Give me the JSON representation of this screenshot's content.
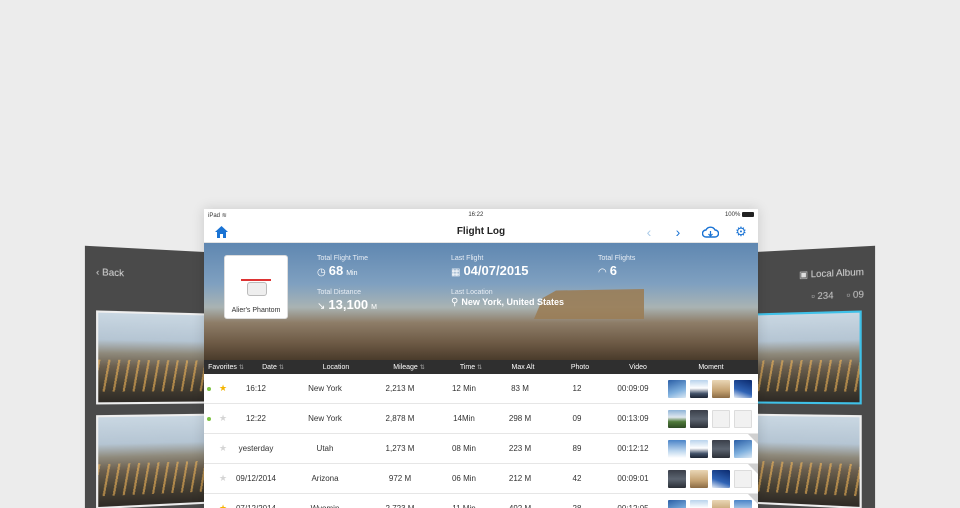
{
  "left_panel": {
    "back_label": "Back"
  },
  "right_panel": {
    "album_label": "Local Album",
    "photo_count": "234",
    "video_count": "09"
  },
  "status_bar": {
    "device": "iPad",
    "time": "16:22",
    "battery": "100%"
  },
  "nav": {
    "title": "Flight Log"
  },
  "aircraft": {
    "name": "Alier's Phantom"
  },
  "stats": {
    "total_flight_time": {
      "label": "Total Flight Time",
      "value": "68",
      "unit": "Min"
    },
    "last_flight": {
      "label": "Last Flight",
      "value": "04/07/2015"
    },
    "total_flights": {
      "label": "Total Flights",
      "value": "6"
    },
    "total_distance": {
      "label": "Total Distance",
      "value": "13,100",
      "unit": "M"
    },
    "last_location": {
      "label": "Last Location",
      "value": "New York, United States"
    }
  },
  "table": {
    "headers": [
      "Favorites",
      "Date",
      "Location",
      "Mileage",
      "Time",
      "Max Alt",
      "Photo",
      "Video",
      "Moment"
    ],
    "rows": [
      {
        "dot": true,
        "fav": true,
        "date": "16:12",
        "location": "New York",
        "mileage": "2,213 M",
        "time": "12 Min",
        "max_alt": "83 M",
        "photo": "12",
        "video": "00:09:09",
        "moments": [
          "t-sky",
          "t-mnt",
          "t-sand",
          "t-deep"
        ],
        "corner": false
      },
      {
        "dot": true,
        "fav": false,
        "date": "12:22",
        "location": "New York",
        "mileage": "2,878 M",
        "time": "14Min",
        "max_alt": "298 M",
        "photo": "09",
        "video": "00:13:09",
        "moments": [
          "t-grn",
          "t-dark",
          "t-empty",
          "t-empty"
        ],
        "corner": false
      },
      {
        "dot": false,
        "fav": false,
        "date": "yesterday",
        "location": "Utah",
        "mileage": "1,273 M",
        "time": "08 Min",
        "max_alt": "223 M",
        "photo": "89",
        "video": "00:12:12",
        "moments": [
          "t-blue",
          "t-mnt",
          "t-dark",
          "t-sky"
        ],
        "corner": true
      },
      {
        "dot": false,
        "fav": false,
        "date": "09/12/2014",
        "location": "Arizona",
        "mileage": "972 M",
        "time": "06 Min",
        "max_alt": "212 M",
        "photo": "42",
        "video": "00:09:01",
        "moments": [
          "t-dark",
          "t-sand",
          "t-deep",
          "t-empty"
        ],
        "corner": true
      },
      {
        "dot": false,
        "fav": true,
        "date": "07/12/2014",
        "location": "Wyomin",
        "mileage": "2,723 M",
        "time": "11 Min",
        "max_alt": "492 M",
        "photo": "28",
        "video": "00:12:05",
        "moments": [
          "t-sky",
          "t-mnt",
          "t-sand",
          "t-blue"
        ],
        "corner": true
      }
    ]
  },
  "colors": {
    "accent": "#1a73d4",
    "header_bg": "#2f2f2f",
    "favorite": "#f4b400",
    "active_dot": "#7cc242"
  }
}
